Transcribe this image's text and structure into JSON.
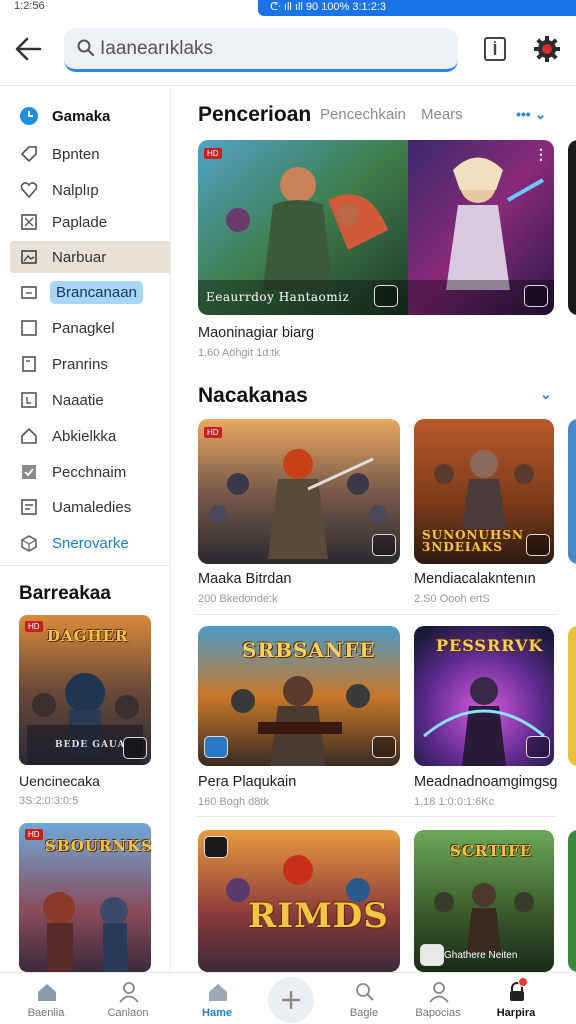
{
  "status_bar": {
    "time": "1:2:56",
    "indicators": "ᕦᐧ ıll ıll 90 100% 3:1:2:3"
  },
  "search": {
    "value": "Iaanearıklaks"
  },
  "sidebar": {
    "items": [
      {
        "label": "Gamaka",
        "icon": "clock-icon",
        "kind": "head"
      },
      {
        "label": "Bpnten",
        "icon": "tag-icon"
      },
      {
        "label": "Nalplıp",
        "icon": "heart-icon"
      },
      {
        "label": "Paplade",
        "icon": "box-icon"
      },
      {
        "label": "Narbuar",
        "icon": "image-icon",
        "kind": "active"
      },
      {
        "label": "Brancanaan",
        "icon": "screen-icon",
        "kind": "pill"
      },
      {
        "label": "Panagkel",
        "icon": "square-icon"
      },
      {
        "label": "Pranrins",
        "icon": "document-icon"
      },
      {
        "label": "Naaatie",
        "icon": "mail-icon"
      },
      {
        "label": "Abkielkka",
        "icon": "home-icon"
      },
      {
        "label": "Pecchnaim",
        "icon": "check-icon"
      },
      {
        "label": "Uamaledies",
        "icon": "list-icon"
      },
      {
        "label": "Snerovarke",
        "icon": "cube-icon",
        "kind": "link"
      }
    ],
    "section_title": "Barreakaa",
    "cards": [
      {
        "title": "Uencinecaka",
        "meta": "3S:2:0:3:0:5",
        "logo": "DAGHER",
        "corner": "BEDE GAUA",
        "theme": "armor"
      },
      {
        "title": "",
        "meta": "",
        "logo": "SBOURNKS",
        "corner": "",
        "theme": "heroes"
      }
    ]
  },
  "section1": {
    "title": "Pencerioan",
    "tabs": [
      "Pencechkain",
      "Mears"
    ],
    "more": "••• ⌄",
    "cards": [
      {
        "title": "Maoninagiar biarg",
        "meta": "1.60 Aöhgit 1d:tk",
        "banner": "Eeaurrdoy Hantaomiz",
        "theme": "fantasy"
      }
    ]
  },
  "section2": {
    "title": "Nacakanas",
    "more": "⌄",
    "rows": [
      [
        {
          "title": "Maaka Bitrdan",
          "meta": "200 Bkedonde:k",
          "logo": "",
          "theme": "warriors"
        },
        {
          "title": "Mendiacalakntenın",
          "meta": "2.S0 Oooh ertS",
          "logo": "SUNONUHSN 3NDEIAKS",
          "theme": "fire"
        }
      ],
      [
        {
          "title": "Pera Plaqukain",
          "meta": "160 Bogh d8tk",
          "logo": "SRBSANFE",
          "theme": "fire"
        },
        {
          "title": "Meadnadnoamgimgsg",
          "meta": "1.18 1:0:0:1:6Kc",
          "logo": "PESSRRVK",
          "theme": "magic"
        }
      ],
      [
        {
          "title": "",
          "meta": "",
          "logo": "RIMDS",
          "theme": "heroes"
        },
        {
          "title": "",
          "meta": "",
          "logo": "SCRTIFE",
          "theme": "forest",
          "corner": "Ghathere Neiten"
        }
      ]
    ]
  },
  "bottom_nav": [
    {
      "label": "Baeniia",
      "icon": "home-icon"
    },
    {
      "label": "Canlaon",
      "icon": "user-icon"
    },
    {
      "label": "Hame",
      "icon": "home-icon",
      "active": true
    },
    {
      "label": "",
      "icon": "plus-icon"
    },
    {
      "label": "Bagle",
      "icon": "search-icon"
    },
    {
      "label": "Bapocias",
      "icon": "user-icon"
    },
    {
      "label": "Harpira",
      "icon": "lock-icon",
      "bold": true,
      "badge": "1"
    }
  ],
  "colors": {
    "accent": "#1c7fd6",
    "status_bar": "#1a73e8",
    "pill": "#a9d6f8",
    "active_row": "#e7e1d6"
  }
}
